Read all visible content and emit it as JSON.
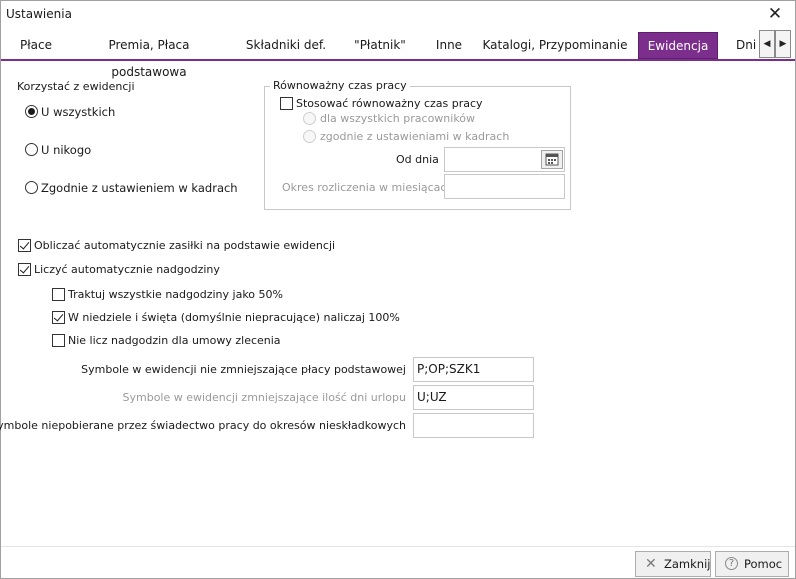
{
  "window": {
    "title": "Ustawienia",
    "close_glyph": "✕"
  },
  "tabs": [
    {
      "label": "Płace"
    },
    {
      "label": "Premia, Płaca podstawowa"
    },
    {
      "label": "Składniki def."
    },
    {
      "label": "\"Płatnik\""
    },
    {
      "label": "Inne"
    },
    {
      "label": "Katalogi, Przypominanie"
    },
    {
      "label": "Ewidencja",
      "active": true
    },
    {
      "label": "Dni"
    }
  ],
  "tab_scroll": {
    "left_icon": "caret-left-icon",
    "right_icon": "caret-right-icon",
    "left_glyph": "◀",
    "right_glyph": "▶"
  },
  "usage": {
    "title": "Korzystać z ewidencji",
    "options": [
      {
        "label": "U wszystkich",
        "checked": true
      },
      {
        "label": "U nikogo",
        "checked": false
      },
      {
        "label": "Zgodnie z ustawieniem w kadrach",
        "checked": false
      }
    ]
  },
  "equivalent": {
    "title": "Równoważny czas pracy",
    "use_label": "Stosować równoważny czas pracy",
    "use_checked": false,
    "sub_options": [
      {
        "label": "dla wszystkich pracowników"
      },
      {
        "label": "zgodnie z ustawieniami w kadrach"
      }
    ],
    "from_day_label": "Od dnia",
    "from_day_value": "",
    "calendar_icon": "calendar-icon",
    "period_label": "Okres rozliczenia w miesiącach",
    "period_value": ""
  },
  "options": {
    "benefits_label": "Obliczać automatycznie zasiłki na podstawie ewidencji",
    "benefits_checked": true,
    "overtime_label": "Liczyć automatycznie nadgodziny",
    "overtime_checked": true,
    "sub": [
      {
        "label": "Traktuj wszystkie nadgodziny jako 50%",
        "checked": false
      },
      {
        "label": "W niedziele i święta (domyślnie niepracujące) naliczaj 100%",
        "checked": true
      },
      {
        "label": "Nie licz nadgodzin dla umowy zlecenia",
        "checked": false
      }
    ]
  },
  "symbols": {
    "rows": [
      {
        "label": "Symbole w ewidencji nie zmniejszające płacy podstawowej",
        "value": "P;OP;SZK1",
        "dim": false
      },
      {
        "label": "Symbole w ewidencji zmniejszające ilość dni urlopu",
        "value": "U;UZ",
        "dim": true
      },
      {
        "label": "Symbole niepobierane przez świadectwo pracy do okresów nieskładkowych",
        "value": "",
        "dim": false
      }
    ]
  },
  "footer": {
    "close_label": "Zamknij",
    "close_glyph": "✕",
    "help_label": "Pomoc",
    "help_glyph": "?"
  }
}
